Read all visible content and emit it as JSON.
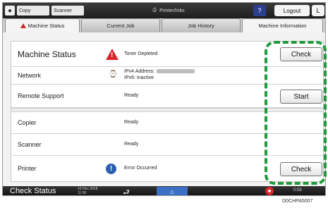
{
  "topbar": {
    "user_icon": "user-icon",
    "copy_label": "Copy",
    "scanner_label": "Scanner",
    "center_label": "Printer/Inks",
    "help_label": "?",
    "logout_label": "Logout",
    "key_label": "L"
  },
  "tabs": [
    {
      "label": "Machine Status",
      "active": true,
      "icon": "warning-icon"
    },
    {
      "label": "Current Job",
      "active": false
    },
    {
      "label": "Job History",
      "active": false
    },
    {
      "label": "Machine Information",
      "active": false
    }
  ],
  "rows": {
    "machine_status": {
      "label": "Machine Status",
      "icon": "warning-icon",
      "value": "Toner Depleted",
      "button": "Check"
    },
    "network": {
      "label": "Network",
      "icon": "network-icon",
      "value_line1": "IPv4 Address:",
      "value_line2": "IPv6: Inactive"
    },
    "remote_support": {
      "label": "Remote Support",
      "value": "Ready",
      "button": "Start"
    },
    "copier": {
      "label": "Copier",
      "value": "Ready"
    },
    "scanner": {
      "label": "Scanner",
      "value": "Ready"
    },
    "printer": {
      "label": "Printer",
      "icon": "info-icon",
      "value": "Error Occurred",
      "button": "Check"
    }
  },
  "bottombar": {
    "check_status": "Check Status",
    "date_line1": "10 Dec 2018",
    "date_line2": "11:58",
    "back_icon": "back-icon",
    "home_icon": "home-icon",
    "stop_icon": "stop-icon",
    "right_text": "0:58"
  },
  "caption": "D0CHPA5007",
  "colors": {
    "highlight": "#1f9a3a",
    "warning": "#d7262b",
    "info": "#2b5fb0"
  }
}
